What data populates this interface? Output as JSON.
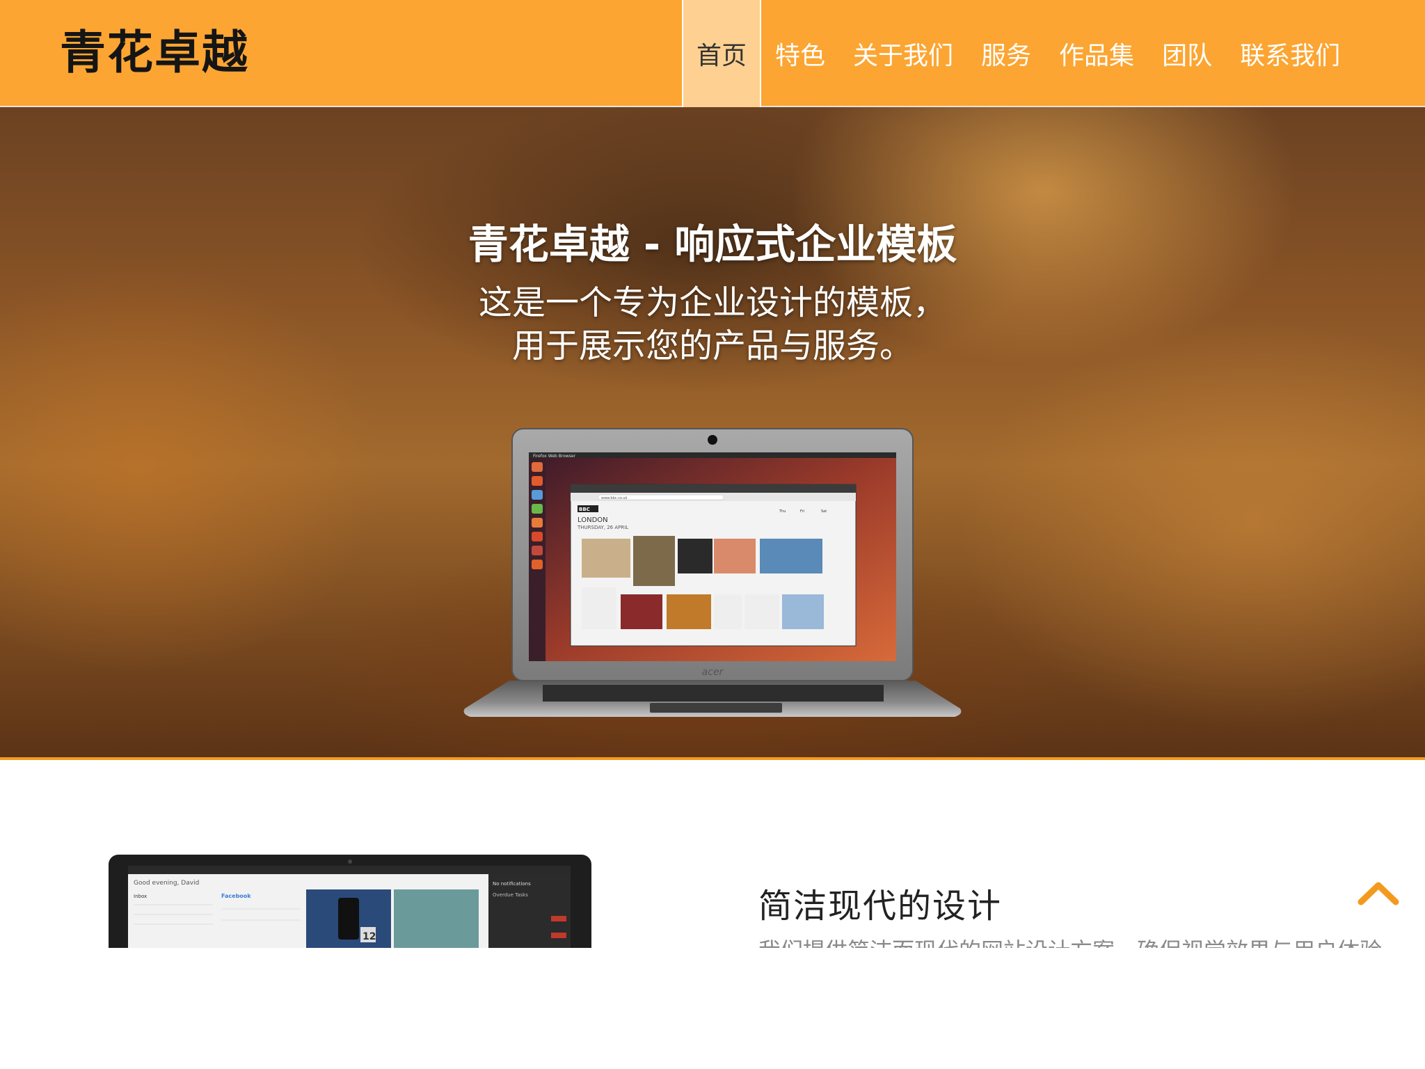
{
  "header": {
    "brand": "青花卓越",
    "nav": [
      {
        "label": "首页",
        "active": true
      },
      {
        "label": "特色"
      },
      {
        "label": "关于我们"
      },
      {
        "label": "服务"
      },
      {
        "label": "作品集"
      },
      {
        "label": "团队"
      },
      {
        "label": "联系我们"
      }
    ]
  },
  "hero": {
    "title": "青花卓越 - 响应式企业模板",
    "subtitle_line1": "这是一个专为企业设计的模板，",
    "subtitle_line2": "用于展示您的产品与服务。",
    "laptop": {
      "brand": "acer",
      "screen": {
        "topbar_app": "Firefox Web Browser",
        "browser_url": "www.bbc.co.uk",
        "site_logo": "BBC",
        "headline": "LONDON",
        "date": "THURSDAY, 26 APRIL",
        "weather_days": [
          "Thu",
          "Fri",
          "Sat"
        ]
      }
    }
  },
  "feature": {
    "title": "简洁现代的设计",
    "description": "我们提供简洁而现代的网站设计方案，确保视觉效果与用户体验",
    "tablet_screen": {
      "greeting": "Good evening, David",
      "inbox_label": "Inbox",
      "facebook_label": "Facebook",
      "notifications": "No notifications",
      "overdue": "Overdue Tasks",
      "badge": "12"
    }
  },
  "colors": {
    "header_bg": "#fca532",
    "nav_active_bg": "#fed091",
    "accent": "#f39a1e"
  },
  "icons": {
    "scroll_top": "chevron-up-icon"
  }
}
